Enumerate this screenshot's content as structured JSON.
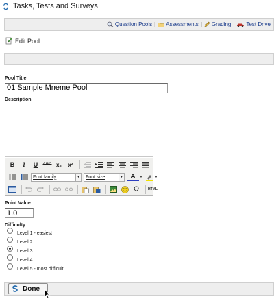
{
  "window": {
    "title": "Tasks, Tests and Surveys"
  },
  "nav": {
    "items": [
      {
        "label": "Question Pools",
        "icon": "question-pools-icon"
      },
      {
        "label": "Assessments",
        "icon": "folder-icon"
      },
      {
        "label": "Grading",
        "icon": "pencil-icon"
      },
      {
        "label": "Test Drive",
        "icon": "car-icon"
      }
    ],
    "separator": "|"
  },
  "page": {
    "heading": "Edit Pool",
    "heading_icon": "edit-icon"
  },
  "form": {
    "pool_title_label": "Pool Title",
    "pool_title_value": "01 Sample Mneme Pool",
    "description_label": "Description",
    "description_value": "",
    "point_value_label": "Point Value",
    "point_value": "1.0",
    "difficulty_label": "Difficulty",
    "difficulty_options": [
      "Level 1 - easiest",
      "Level 2",
      "Level 3",
      "Level 4",
      "Level 5 - most difficult"
    ],
    "difficulty_selected": "Level 3"
  },
  "editor_toolbar": {
    "bold": "B",
    "italic": "I",
    "underline": "U",
    "strikethrough": "ABC",
    "subscript": "x₂",
    "superscript": "x²",
    "font_family": "Font family",
    "font_size": "Font size",
    "font_color": "A",
    "special_char": "Ω",
    "html": "HTML"
  },
  "actions": {
    "done_label": "Done",
    "done_icon": "sakai-s-icon"
  },
  "colors": {
    "link": "#1b3c8c",
    "bar_bg": "#eeeeee",
    "toolbar_bg": "#f0f0ee"
  }
}
